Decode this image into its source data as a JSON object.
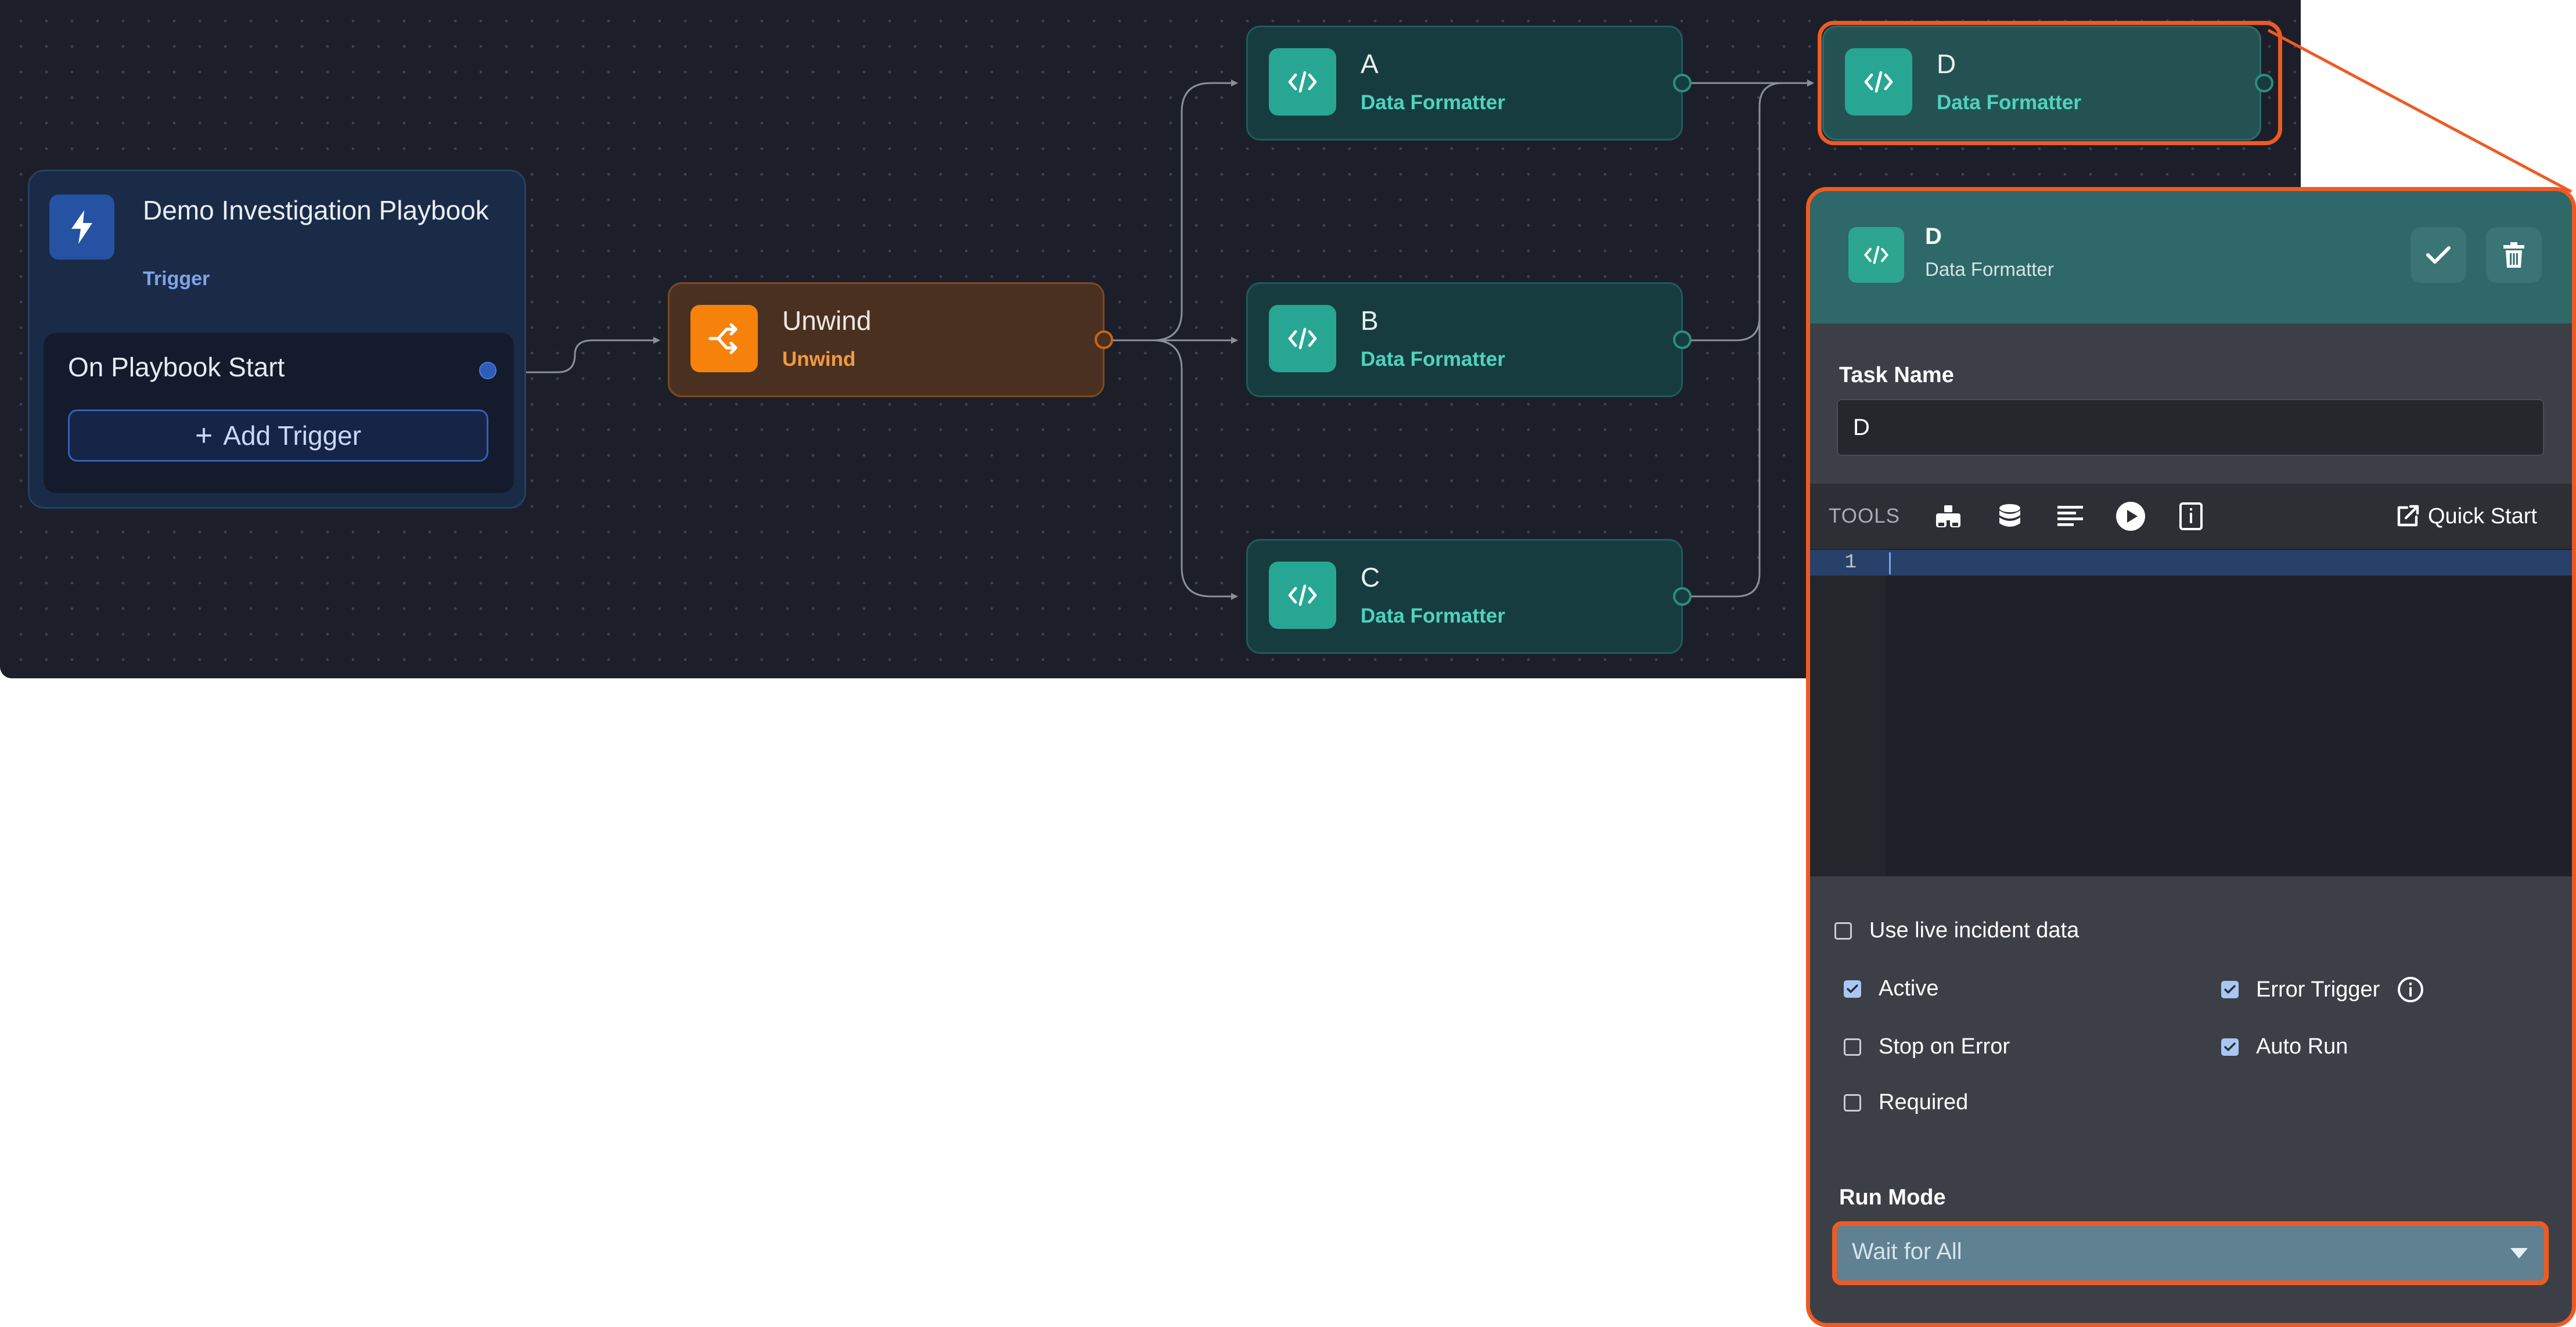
{
  "trigger_node": {
    "title": "Demo Investigation Playbook",
    "subtitle": "Trigger",
    "start_label": "On Playbook Start",
    "add_trigger_label": "Add Trigger"
  },
  "unwind_node": {
    "title": "Unwind",
    "subtitle": "Unwind"
  },
  "nodes": [
    {
      "title": "A",
      "subtitle": "Data Formatter"
    },
    {
      "title": "B",
      "subtitle": "Data Formatter"
    },
    {
      "title": "C",
      "subtitle": "Data Formatter"
    },
    {
      "title": "D",
      "subtitle": "Data Formatter"
    }
  ],
  "panel": {
    "title": "D",
    "subtitle": "Data Formatter",
    "task_name_label": "Task Name",
    "task_name_value": "D",
    "tools_label": "TOOLS",
    "quick_start_label": "Quick Start",
    "editor": {
      "line_number": "1",
      "code": ""
    },
    "options": {
      "use_live_data": {
        "label": "Use live incident data",
        "checked": false
      },
      "active": {
        "label": "Active",
        "checked": true
      },
      "error_trigger": {
        "label": "Error Trigger",
        "checked": true
      },
      "stop_on_error": {
        "label": "Stop on Error",
        "checked": false
      },
      "auto_run": {
        "label": "Auto Run",
        "checked": true
      },
      "required": {
        "label": "Required",
        "checked": false
      }
    },
    "run_mode_label": "Run Mode",
    "run_mode_value": "Wait for All"
  },
  "colors": {
    "canvas_bg": "#1c1f29",
    "selection_accent": "#ee5a24",
    "trigger_accent": "#2552a2",
    "unwind_accent": "#f6820c",
    "formatter_accent": "#27a693",
    "panel_header": "#2e6868"
  },
  "icons": {
    "trigger": "bolt-icon",
    "unwind": "shuffle-icon",
    "formatter": "code-icon",
    "save": "check-icon",
    "delete": "trash-icon",
    "tools": [
      "tag-search-icon",
      "database-icon",
      "align-left-icon",
      "play-circle-icon",
      "document-info-icon"
    ],
    "quick_start": "external-link-icon"
  }
}
